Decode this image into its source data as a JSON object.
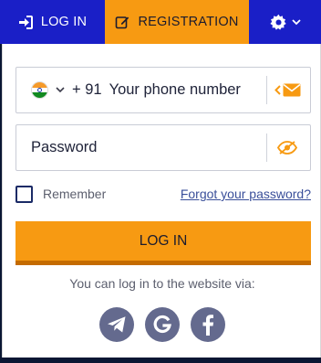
{
  "tabs": {
    "login_label": "LOG IN",
    "registration_label": "REGISTRATION"
  },
  "phone": {
    "country_code": "+ 91",
    "placeholder": "Your phone number",
    "country_flag": "india-flag-icon"
  },
  "password": {
    "placeholder": "Password"
  },
  "remember": {
    "label": "Remember",
    "checked": false
  },
  "forgot_label": "Forgot your password?",
  "login_button_label": "LOG IN",
  "via_text": "You can log in to the website via:",
  "socials": [
    "telegram-icon",
    "google-icon",
    "facebook-icon"
  ],
  "colors": {
    "accent_orange": "#f79a12",
    "nav_blue": "#1a1fc7",
    "social_gray": "#646a8e"
  }
}
